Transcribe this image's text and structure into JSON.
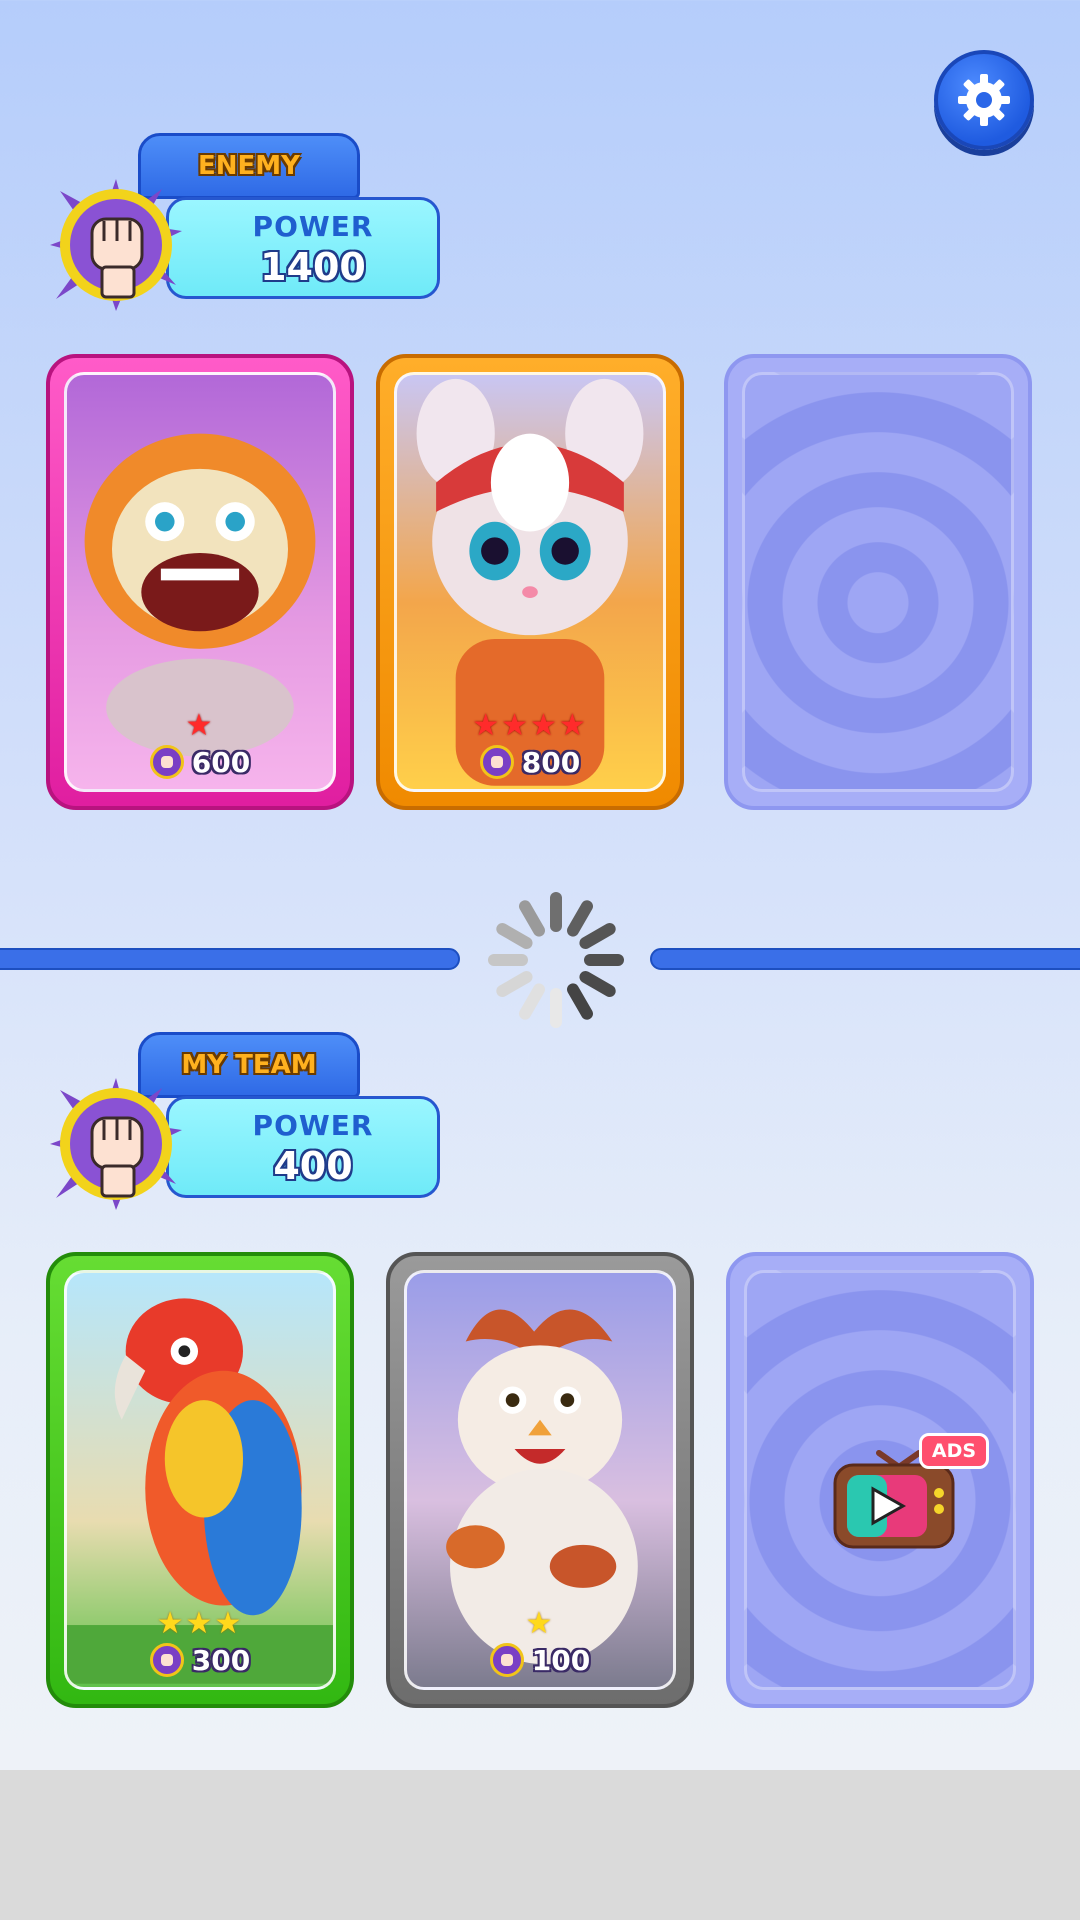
{
  "settings": {
    "icon": "gear-icon"
  },
  "enemy": {
    "tag": "ENEMY",
    "power_label": "POWER",
    "power_value": "1400",
    "cards": [
      {
        "name": "furry-monster",
        "frame": "pink",
        "stars": "★",
        "star_count": 1,
        "star_color": "red",
        "power": "600"
      },
      {
        "name": "robot-bunny",
        "frame": "orange",
        "stars": "★★★★",
        "star_count": 4,
        "star_color": "red",
        "power": "800"
      },
      {
        "name": "empty-slot",
        "frame": "empty"
      }
    ]
  },
  "my_team": {
    "tag": "MY TEAM",
    "power_label": "POWER",
    "power_value": "400",
    "cards": [
      {
        "name": "parrot",
        "frame": "green",
        "stars": "★★★",
        "star_count": 3,
        "star_color": "gold",
        "power": "300"
      },
      {
        "name": "chicken",
        "frame": "gray",
        "stars": "★",
        "star_count": 1,
        "star_color": "gold",
        "power": "100"
      },
      {
        "name": "ads-slot",
        "frame": "empty",
        "ads_label": "ADS"
      }
    ]
  },
  "colors": {
    "divider": "#3a6fe8",
    "tag_text": "#ffb11f",
    "power_box": "#8ef2fc"
  }
}
